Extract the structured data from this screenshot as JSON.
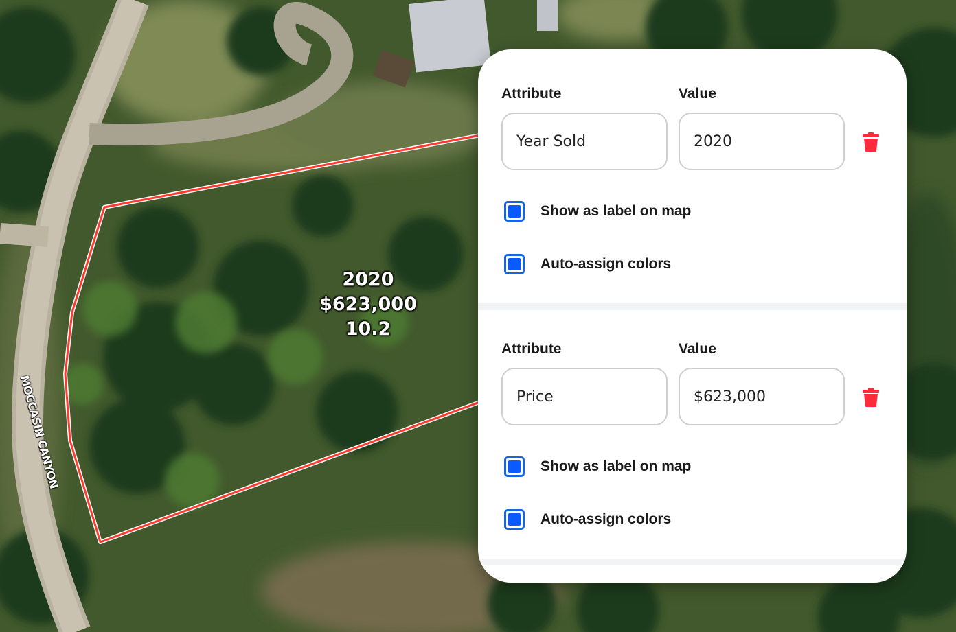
{
  "map": {
    "parcel_label_lines": [
      "2020",
      "$623,000",
      "10.2"
    ],
    "road_name": "MOCCASIN CANYON",
    "boundary_color": "#ff3b30"
  },
  "panel": {
    "entries": [
      {
        "attribute_header": "Attribute",
        "value_header": "Value",
        "attribute": "Year Sold",
        "value": "2020",
        "show_label_text": "Show as label on map",
        "show_label_checked": true,
        "auto_colors_text": "Auto-assign colors",
        "auto_colors_checked": true,
        "delete_icon": "trash-icon"
      },
      {
        "attribute_header": "Attribute",
        "value_header": "Value",
        "attribute": "Price",
        "value": "$623,000",
        "show_label_text": "Show as label on map",
        "show_label_checked": true,
        "auto_colors_text": "Auto-assign colors",
        "auto_colors_checked": true,
        "delete_icon": "trash-icon"
      }
    ],
    "accent_color": "#0a5bff",
    "delete_color": "#ff2b3a"
  }
}
